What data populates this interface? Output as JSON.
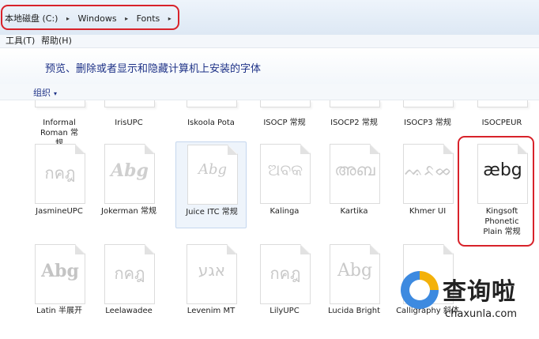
{
  "address": {
    "segments": [
      "本地磁盘 (C:)",
      "Windows",
      "Fonts"
    ],
    "separator": "▸"
  },
  "menu": [
    "工具(T)",
    "帮助(H)"
  ],
  "header": {
    "title": "预览、删除或者显示和隐藏计算机上安装的字体"
  },
  "toolbar": {
    "organize": "组织",
    "organize_arrow": "▾"
  },
  "rows": [
    [
      {
        "name": "Informal Roman 常规",
        "preview": ""
      },
      {
        "name": "IrisUPC",
        "preview": ""
      },
      {
        "name": "Iskoola Pota",
        "preview": ""
      },
      {
        "name": "ISOCP 常规",
        "preview": ""
      },
      {
        "name": "ISOCP2 常规",
        "preview": ""
      },
      {
        "name": "ISOCP3 常规",
        "preview": ""
      },
      {
        "name": "ISOCPEUR",
        "preview": ""
      }
    ],
    [
      {
        "name": "JasmineUPC",
        "preview": "กคฎ"
      },
      {
        "name": "Jokerman 常规",
        "preview": "Abg"
      },
      {
        "name": "Juice ITC 常规",
        "preview": "Abg",
        "selected": true
      },
      {
        "name": "Kalinga",
        "preview": "ଅବକ"
      },
      {
        "name": "Kartika",
        "preview": "അബ"
      },
      {
        "name": "Khmer UI",
        "preview": "ᨕᨅᨖ"
      },
      {
        "name": "Kingsoft Phonetic Plain 常规",
        "preview": "æbg"
      }
    ],
    [
      {
        "name": "Latin 半展开",
        "preview": "Abg"
      },
      {
        "name": "Leelawadee",
        "preview": "กคฎ"
      },
      {
        "name": "Levenim MT",
        "preview": "אגע"
      },
      {
        "name": "LilyUPC",
        "preview": "กคฎ"
      },
      {
        "name": "Lucida Bright",
        "preview": "Abg"
      },
      {
        "name": "Calligraphy 斜体",
        "preview": ""
      }
    ]
  ],
  "watermark": {
    "title": "查询啦",
    "url": "chaxunla.com"
  },
  "colors": {
    "highlight": "#d8222a",
    "link": "#1e3287",
    "watermark_yellow": "#f3b10a",
    "watermark_blue": "#3d8ae0"
  }
}
